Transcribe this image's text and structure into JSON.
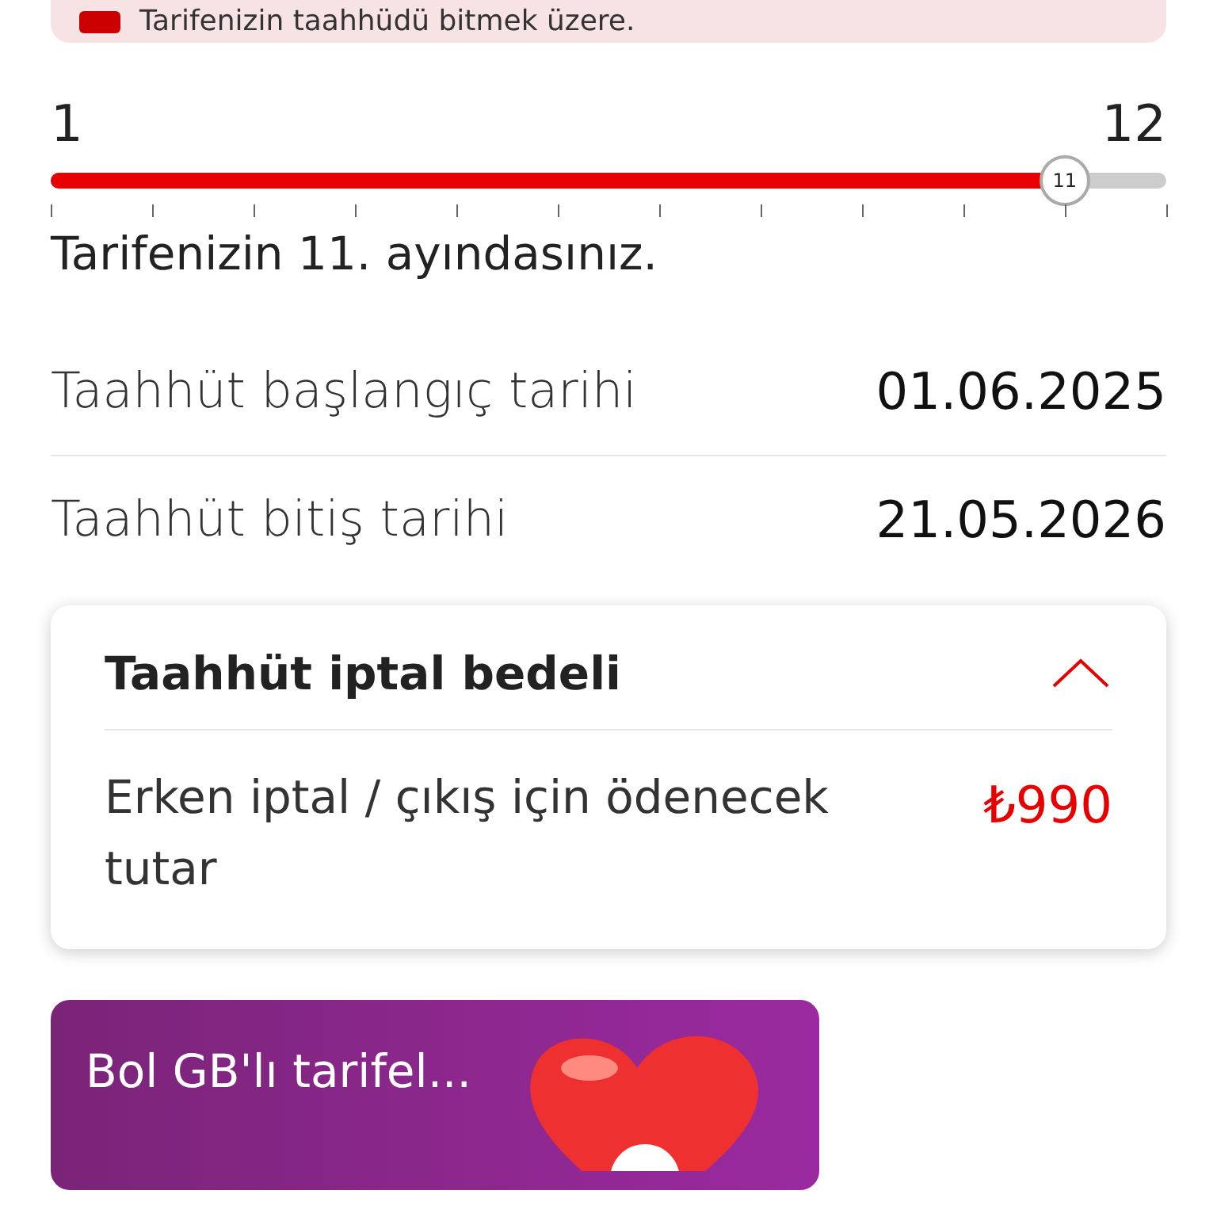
{
  "alert": {
    "text": "Tarifenizin taahhüdü bitmek üzere."
  },
  "progress": {
    "min_label": "1",
    "max_label": "12",
    "thumb_label": "11",
    "level": 0.909,
    "caption": "Tarifenizin 11. ayındasınız."
  },
  "details": [
    {
      "label": "Taahhüt başlangıç tarihi",
      "value": "01.06.2025"
    },
    {
      "label": "Taahhüt bitiş tarihi",
      "value": "21.05.2026"
    }
  ],
  "fee_card": {
    "title": "Taahhüt iptal bedeli",
    "expanded": true,
    "description": "Erken iptal / çıkış için ödenecek tutar",
    "amount": "₺990"
  },
  "promo": {
    "title": "Bol GB'lı tarifel..."
  }
}
